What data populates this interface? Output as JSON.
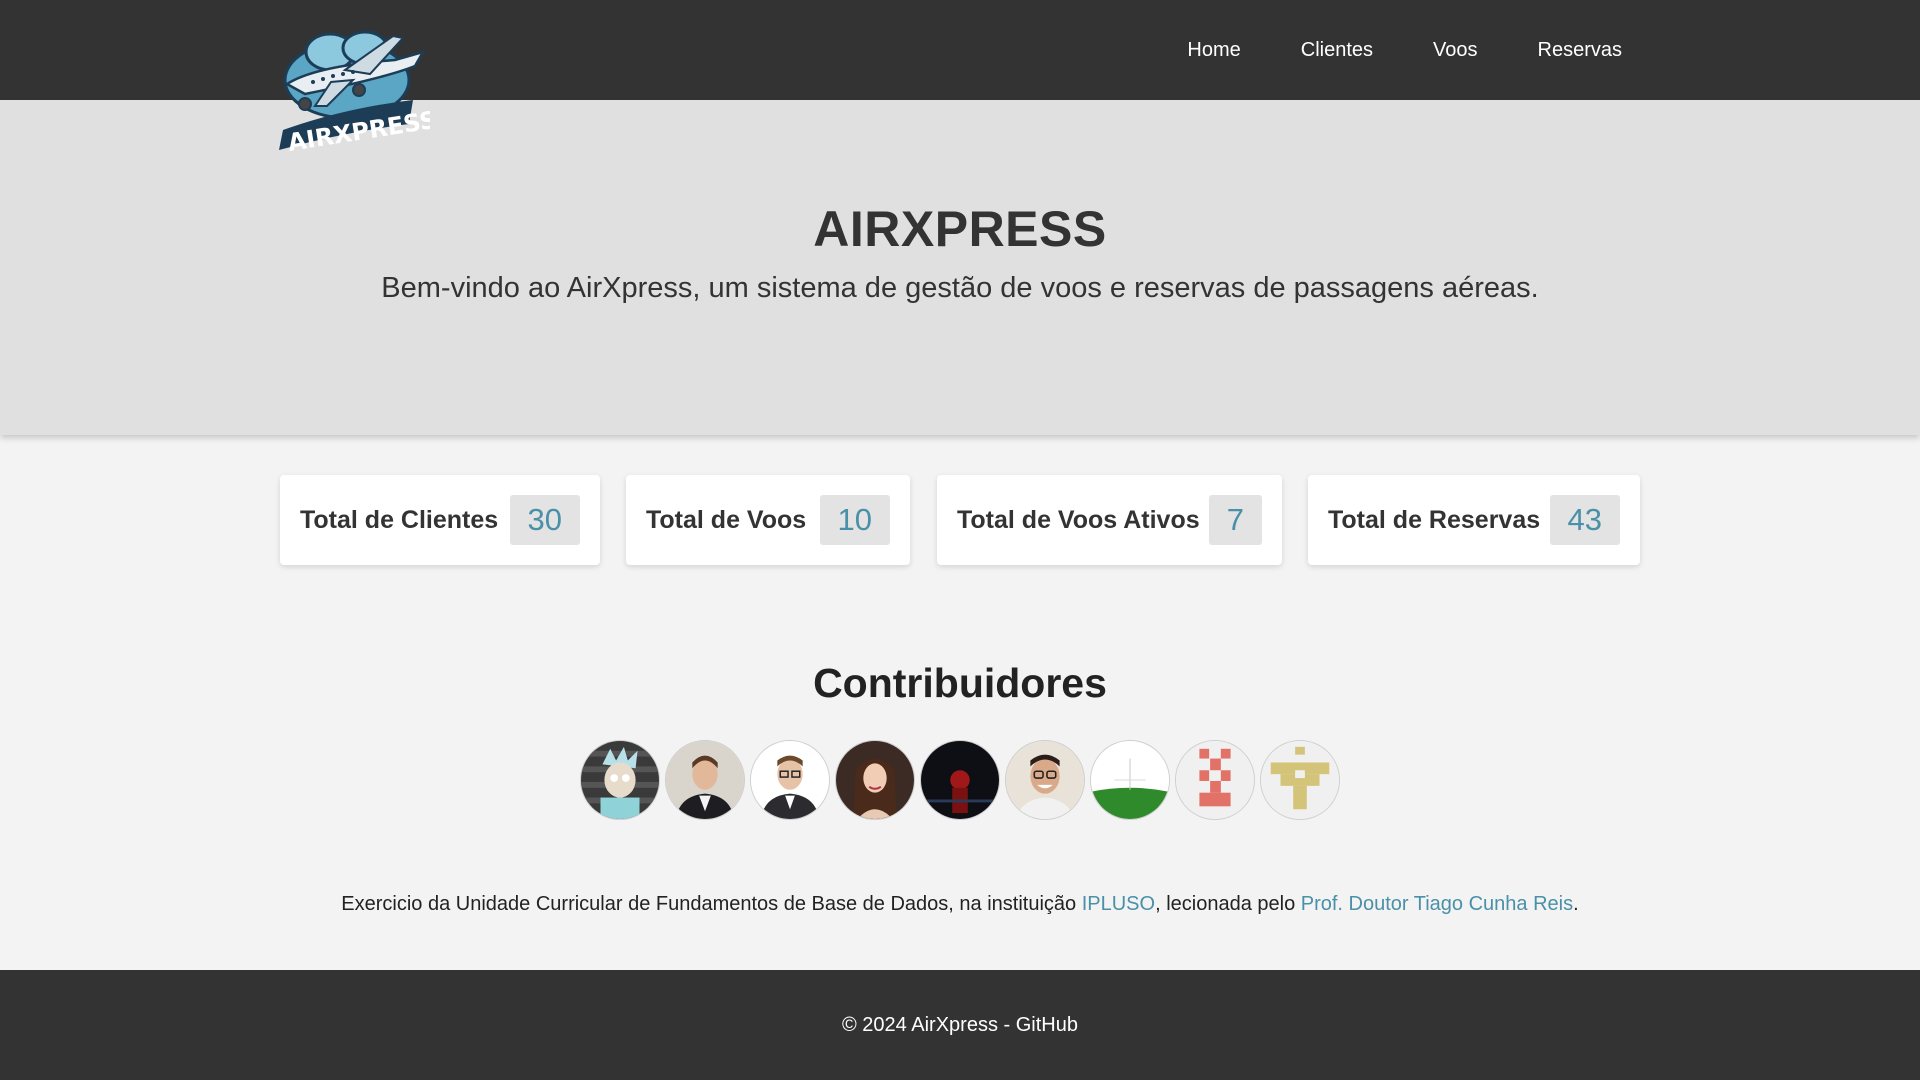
{
  "header": {
    "logo_text": "AIRXPRESS",
    "nav": [
      {
        "label": "Home"
      },
      {
        "label": "Clientes"
      },
      {
        "label": "Voos"
      },
      {
        "label": "Reservas"
      }
    ]
  },
  "hero": {
    "title": "AIRXPRESS",
    "subtitle": "Bem-vindo ao AirXpress, um sistema de gestão de voos e reservas de passagens aéreas."
  },
  "stats": [
    {
      "label": "Total de Clientes",
      "value": "30"
    },
    {
      "label": "Total de Voos",
      "value": "10"
    },
    {
      "label": "Total de Voos Ativos",
      "value": "7"
    },
    {
      "label": "Total de Reservas",
      "value": "43"
    }
  ],
  "contributors": {
    "title": "Contribuidores",
    "avatars": [
      {
        "icon": "rick-cartoon-avatar"
      },
      {
        "icon": "man-suit-avatar"
      },
      {
        "icon": "man-glasses-avatar"
      },
      {
        "icon": "woman-avatar"
      },
      {
        "icon": "dark-night-avatar"
      },
      {
        "icon": "man-glasses-smiling-avatar"
      },
      {
        "icon": "green-field-avatar"
      },
      {
        "icon": "identicon-red-avatar"
      },
      {
        "icon": "identicon-gold-avatar"
      }
    ]
  },
  "credits": {
    "prefix": "Exercicio da Unidade Curricular de Fundamentos de Base de Dados, na instituição ",
    "institution": "IPLUSO",
    "middle": ", lecionada pelo ",
    "professor": "Prof. Doutor Tiago Cunha Reis",
    "suffix": "."
  },
  "footer": {
    "text": "© 2024 AirXpress - GitHub"
  },
  "colors": {
    "navbar": "#333333",
    "hero_bg": "#e0e0e0",
    "page_bg": "#f3f3f3",
    "accent": "#4a90a8"
  }
}
